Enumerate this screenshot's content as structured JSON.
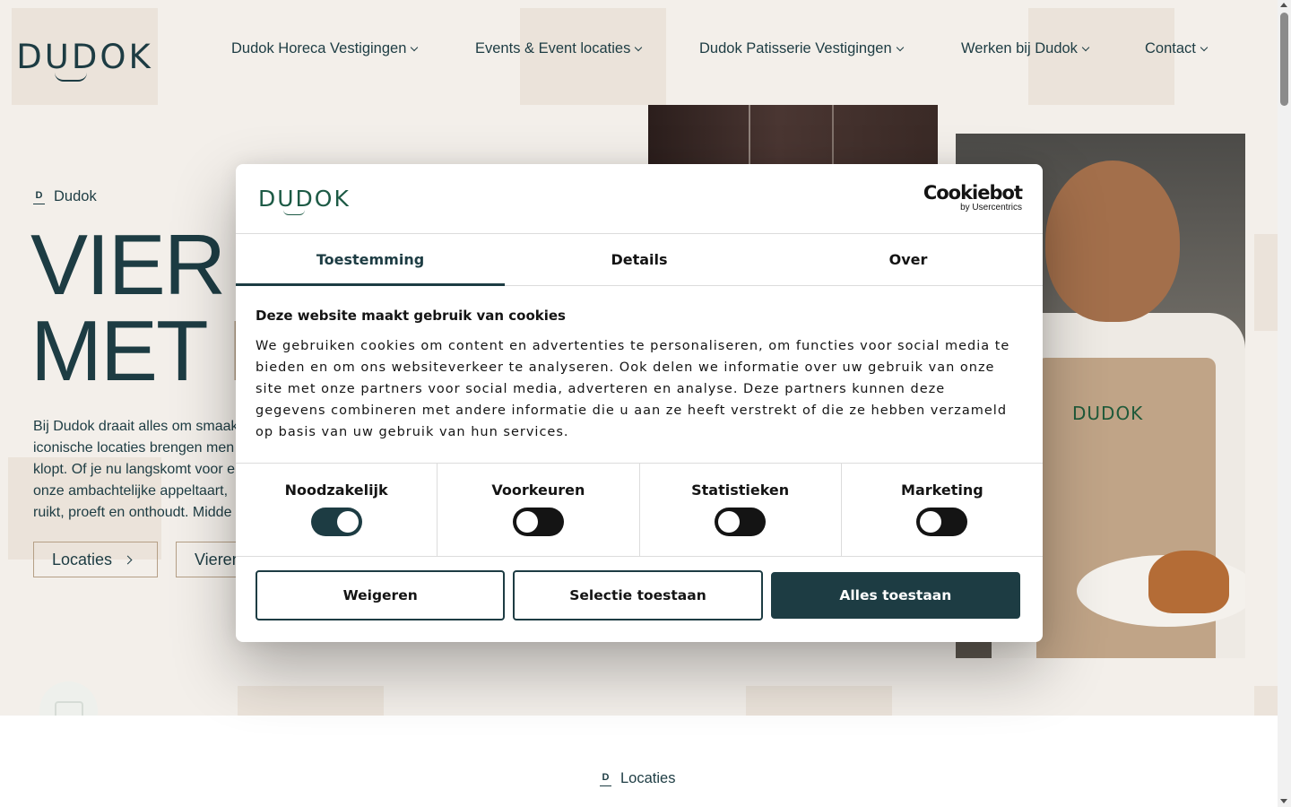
{
  "brand": {
    "logo_text": "DUDOK",
    "colors": {
      "primary": "#1d3c43",
      "accent": "#b59f86",
      "background": "#f3efea"
    }
  },
  "nav": {
    "items": [
      {
        "label": "Dudok Horeca Vestigingen"
      },
      {
        "label": "Events & Event locaties"
      },
      {
        "label": "Dudok Patisserie Vestigingen"
      },
      {
        "label": "Werken bij Dudok"
      },
      {
        "label": "Contact"
      }
    ]
  },
  "hero": {
    "breadcrumb": "Dudok",
    "headline_line1": "VIER '",
    "headline_line2_main": "MET ",
    "headline_line2_accent": "D",
    "intro_lines": [
      "Bij Dudok draait alles om smaak",
      "iconische locaties brengen men",
      "klopt. Of je nu langskomt voor e",
      "onze ambachtelijke appeltaart, ",
      "ruikt, proeft en onthoudt. Midde"
    ],
    "buttons": [
      {
        "label": "Locaties"
      },
      {
        "label": "Vieren"
      }
    ],
    "photo_apron_text": "DUDOK"
  },
  "section": {
    "label": "Locaties"
  },
  "cookie_dialog": {
    "logo_text": "DUDOK",
    "provider_name": "Cookiebot",
    "provider_by": "by Usercentrics",
    "tabs": [
      {
        "label": "Toestemming",
        "active": true
      },
      {
        "label": "Details",
        "active": false
      },
      {
        "label": "Over",
        "active": false
      }
    ],
    "title": "Deze website maakt gebruik van cookies",
    "body": "We gebruiken cookies om content en advertenties te personaliseren, om functies voor social media te bieden en om ons websiteverkeer te analyseren. Ook delen we informatie over uw gebruik van onze site met onze partners voor social media, adverteren en analyse. Deze partners kunnen deze gegevens combineren met andere informatie die u aan ze heeft verstrekt of die ze hebben verzameld op basis van uw gebruik van hun services.",
    "toggles": [
      {
        "label": "Noodzakelijk",
        "on": true
      },
      {
        "label": "Voorkeuren",
        "on": false
      },
      {
        "label": "Statistieken",
        "on": false
      },
      {
        "label": "Marketing",
        "on": false
      }
    ],
    "buttons": {
      "reject": "Weigeren",
      "allow_selection": "Selectie toestaan",
      "allow_all": "Alles toestaan"
    }
  }
}
